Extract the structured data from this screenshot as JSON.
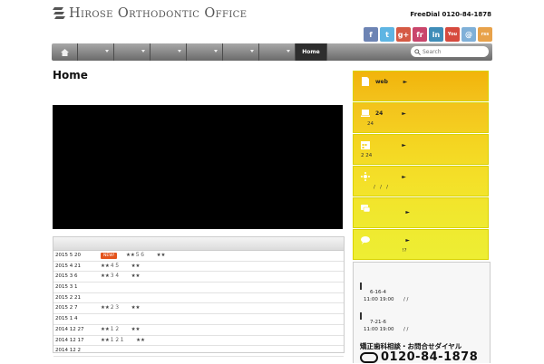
{
  "header": {
    "logo_text": "Hirose Orthodontic Office",
    "free_dial": "FreeDial 0120-84-1878",
    "social": [
      {
        "label": "f",
        "icon": "facebook-icon",
        "color": "#6d84b4"
      },
      {
        "label": "t",
        "icon": "twitter-icon",
        "color": "#5eb5e3"
      },
      {
        "label": "g+",
        "icon": "google-plus-icon",
        "color": "#d55a44"
      },
      {
        "label": "fr",
        "icon": "friendfeed-icon",
        "color": "#c9456b"
      },
      {
        "label": "in",
        "icon": "linkedin-icon",
        "color": "#3f8db8"
      },
      {
        "label": "You",
        "icon": "youtube-icon",
        "color": "#d64a3e"
      },
      {
        "label": "@",
        "icon": "mail-icon",
        "color": "#7fb0d8"
      },
      {
        "label": "rss",
        "icon": "rss-icon",
        "color": "#e8a24a"
      }
    ]
  },
  "nav": {
    "active_label": "Home",
    "search_placeholder": "Search"
  },
  "main": {
    "page_title": "Home",
    "news": [
      {
        "date": "2015 5 20",
        "new": "NEW!",
        "title": "★★５６　　 ★★"
      },
      {
        "date": "2015 4 21",
        "new": "",
        "title": "★★４５　　 ★★"
      },
      {
        "date": "2015 3 6",
        "new": "",
        "title": "★★３４　　 ★★"
      },
      {
        "date": "2015 3 1",
        "new": "",
        "title": ""
      },
      {
        "date": "2015 2 21",
        "new": "",
        "title": ""
      },
      {
        "date": "2015 2 7",
        "new": "",
        "title": "★★２３　　 ★★"
      },
      {
        "date": "2015 1 4",
        "new": "",
        "title": ""
      },
      {
        "date": "2014 12 27",
        "new": "",
        "title": "★★１２　　 ★★"
      },
      {
        "date": "2014 12 17",
        "new": "",
        "title": "★★１２１　　 ★★"
      },
      {
        "date": "2014 12 2",
        "new": "",
        "title": ""
      }
    ]
  },
  "sidebar": {
    "banners": [
      {
        "t1": "web        ►",
        "t2": "",
        "icon": "document-icon"
      },
      {
        "t1": "24          ►",
        "t2": "24",
        "icon": "laptop-icon"
      },
      {
        "t1": "              ►",
        "t2": "2 24",
        "icon": "calendar-icon"
      },
      {
        "t1": "              ►",
        "t2": "        /   /   /",
        "icon": "sparkle-icon"
      },
      {
        "t1": "                ►",
        "t2": "",
        "icon": "chat-icon"
      },
      {
        "t1": "                ►",
        "t2": "                          !?",
        "icon": "speech-bubble-icon"
      }
    ],
    "access": {
      "l1": "6-16-4",
      "l2": "11:00 19:00      / /",
      "l3": "7-21-6",
      "l4": "11:00 19:00      / /",
      "contact": "矯正歯科相談・お問合せダイヤル",
      "phone": "0120-84-1878"
    }
  }
}
